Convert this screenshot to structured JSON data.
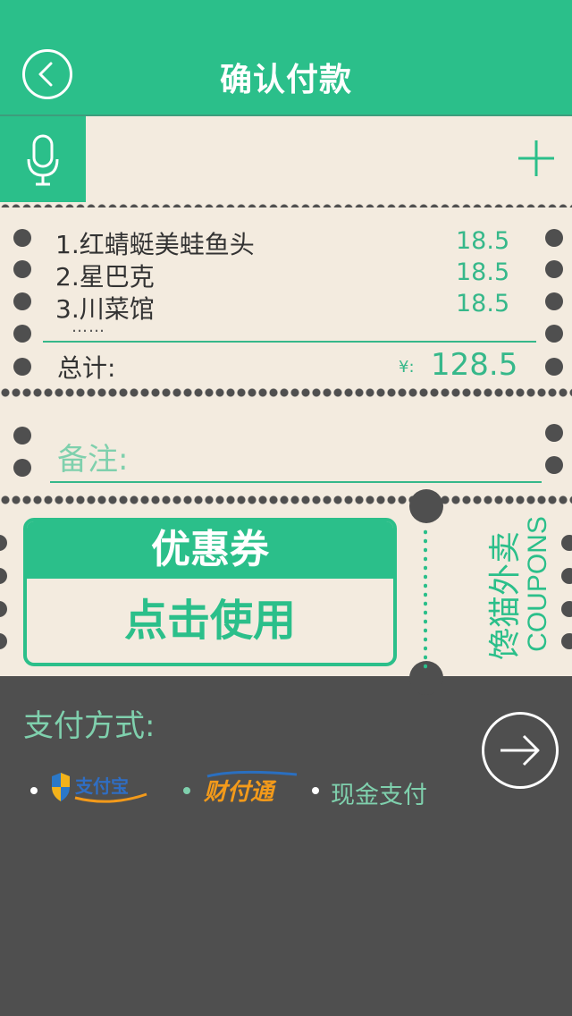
{
  "header": {
    "title": "确认付款"
  },
  "order": {
    "items": [
      {
        "name": "1.红蜻蜓美蛙鱼头",
        "price": "18.5"
      },
      {
        "name": "2.星巴克",
        "price": "18.5"
      },
      {
        "name": "3.川菜馆",
        "price": "18.5"
      }
    ],
    "more": "……",
    "total_label": "总计:",
    "currency_symbol": "¥:",
    "total_value": "128.5"
  },
  "note": {
    "label": "备注:"
  },
  "coupon": {
    "title": "优惠券",
    "action": "点击使用",
    "brand": "馋猫外卖",
    "brand_en": "COUPONS"
  },
  "payment": {
    "label": "支付方式:",
    "options": [
      {
        "label": "支付宝"
      },
      {
        "label": "财付通"
      },
      {
        "label": "现金支付"
      }
    ]
  },
  "colors": {
    "accent": "#2bbf8a",
    "paper": "#f3ebdf",
    "background": "#4f4f4f"
  },
  "icons": [
    "back-icon",
    "microphone-icon",
    "plus-icon",
    "arrow-right-icon",
    "alipay-logo",
    "tenpay-logo"
  ]
}
